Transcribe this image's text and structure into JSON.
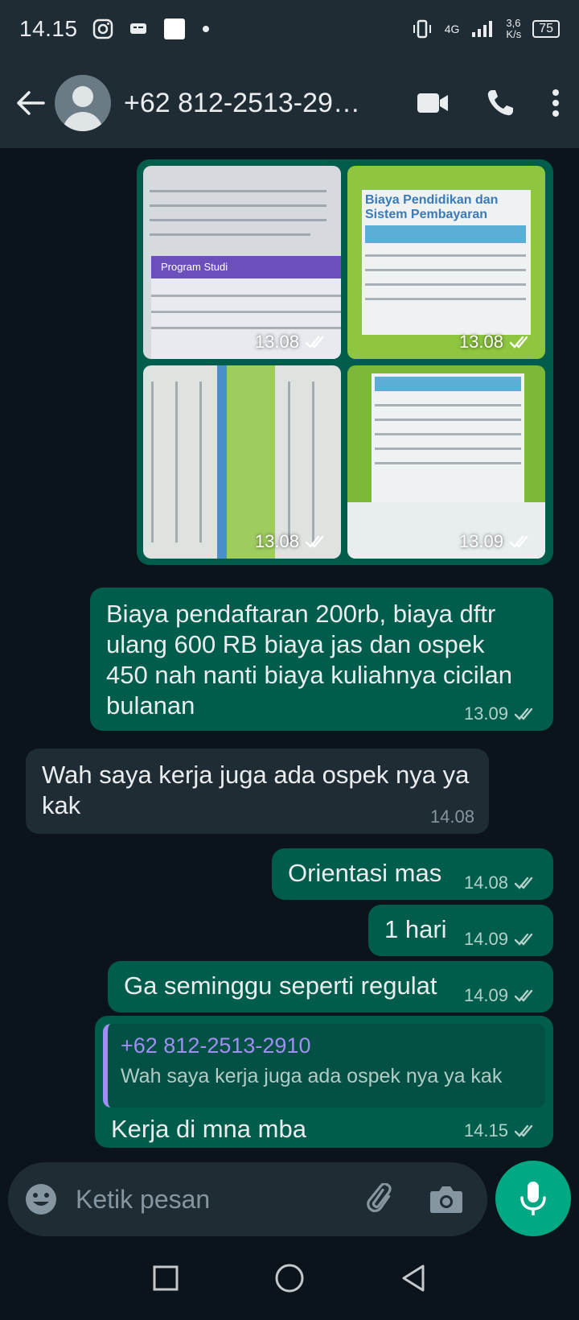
{
  "status_bar": {
    "time": "14.15",
    "network": "4G",
    "speed": "3,6\nK/s",
    "speed_value": "3,6",
    "speed_unit": "K/s",
    "battery": "75"
  },
  "header": {
    "contact_name": "+62 812-2513-29…"
  },
  "messages": {
    "images": [
      {
        "time": "13.08"
      },
      {
        "time": "13.08"
      },
      {
        "time": "13.08"
      },
      {
        "time": "13.09"
      }
    ],
    "m1": {
      "text": "Biaya pendaftaran 200rb, biaya dftr ulang 600 RB biaya jas dan ospek 450 nah nanti biaya kuliahnya cicilan bulanan",
      "time": "13.09"
    },
    "m2": {
      "text": "Wah saya kerja juga ada ospek nya ya kak",
      "time": "14.08"
    },
    "m3": {
      "text": "Orientasi mas",
      "time": "14.08"
    },
    "m4": {
      "text": "1 hari",
      "time": "14.09"
    },
    "m5": {
      "text": "Ga seminggu seperti regulat",
      "time": "14.09"
    },
    "m6": {
      "quote_name": "+62 812-2513-2910",
      "quote_text": "Wah saya kerja juga ada ospek nya ya kak",
      "text": "Kerja di mna mba",
      "time": "14.15"
    }
  },
  "image_text": {
    "img1": "Program Studi",
    "img2_title": "Biaya Pendidikan dan Sistem Pembayaran"
  },
  "composer": {
    "placeholder": "Ketik pesan"
  },
  "colors": {
    "outgoing_bubble": "#005c4b",
    "incoming_bubble": "#202c33",
    "accent": "#00a884",
    "background": "#0b141a"
  },
  "icons": [
    "back-arrow-icon",
    "video-call-icon",
    "phone-icon",
    "more-vert-icon",
    "emoji-icon",
    "attach-icon",
    "camera-icon",
    "mic-icon",
    "double-check-icon"
  ]
}
